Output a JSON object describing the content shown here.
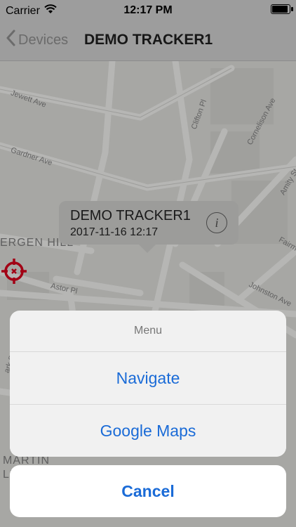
{
  "status_bar": {
    "carrier": "Carrier",
    "time": "12:17 PM"
  },
  "nav": {
    "back_label": "Devices",
    "title": "DEMO TRACKER1"
  },
  "map": {
    "streets": {
      "jewett": "Jewett Ave",
      "gardner": "Gardner Ave",
      "clifton": "Clifton Pl",
      "cornelison": "Cornelison Ave",
      "amity": "Amity St",
      "astor": "Astor Pl",
      "johnston": "Johnston Ave",
      "fairmount": "Fairmo",
      "park": "ark St"
    },
    "neighborhoods": {
      "bergen_hill": "ERGEN HILL",
      "martin1": "MARTIN",
      "martin2": "LU"
    }
  },
  "callout": {
    "title": "DEMO TRACKER1",
    "subtitle": "2017-11-16 12:17"
  },
  "menu": {
    "title": "Menu",
    "items": [
      "Navigate",
      "Google Maps"
    ],
    "cancel": "Cancel"
  },
  "colors": {
    "accent": "#1a6bd7",
    "marker": "#d0021b"
  }
}
